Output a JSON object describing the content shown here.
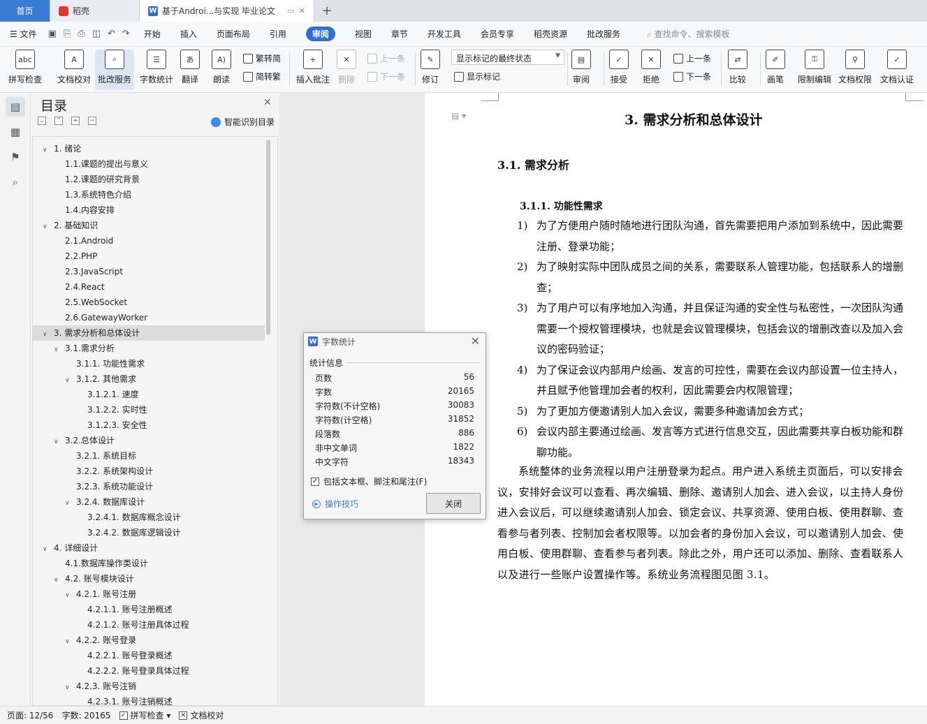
{
  "tabs": [
    {
      "label": "首页"
    },
    {
      "label": "稻壳"
    },
    {
      "label": "基于Androi...与实现 毕业论文"
    }
  ],
  "menu": {
    "file": "文件",
    "items": [
      "开始",
      "插入",
      "页面布局",
      "引用",
      "审阅",
      "视图",
      "章节",
      "开发工具",
      "会员专享",
      "稻壳资源",
      "批改服务"
    ],
    "active": "审阅",
    "search_placeholder": "查找命令、搜索模板"
  },
  "ribbon": {
    "spell_check": "拼写检查",
    "doc_proof": "文档校对",
    "correct_service": "批改服务",
    "word_count": "字数统计",
    "translate": "翻译",
    "read_aloud": "朗读",
    "to_traditional": "繁转简",
    "to_simplified": "简转繁",
    "insert_comment": "插入批注",
    "delete": "删除",
    "prev_comment": "上一条",
    "next_comment": "下一条",
    "track": "修订",
    "markup_state": "显示标记的最终状态",
    "show_markup": "显示标记",
    "review": "审阅",
    "accept": "接受",
    "reject": "拒绝",
    "prev_change": "上一条",
    "next_change": "下一条",
    "compare": "比较",
    "pen": "画笔",
    "restrict_edit": "限制编辑",
    "doc_rights": "文档权限",
    "doc_cert": "文档认证"
  },
  "toc": {
    "title": "目录",
    "smart": "智能识别目录",
    "items": [
      {
        "label": "1. 绪论",
        "level": 1,
        "arrow": "v"
      },
      {
        "label": "1.1.课题的提出与意义",
        "level": 2
      },
      {
        "label": "1.2.课题的研究背景",
        "level": 2
      },
      {
        "label": "1.3.系统特色介绍",
        "level": 2
      },
      {
        "label": "1.4.内容安排",
        "level": 2
      },
      {
        "label": "2. 基础知识",
        "level": 1,
        "arrow": "v"
      },
      {
        "label": "2.1.Android",
        "level": 2
      },
      {
        "label": "2.2.PHP",
        "level": 2
      },
      {
        "label": "2.3.JavaScript",
        "level": 2
      },
      {
        "label": "2.4.React",
        "level": 2
      },
      {
        "label": "2.5.WebSocket",
        "level": 2
      },
      {
        "label": "2.6.GatewayWorker",
        "level": 2
      },
      {
        "label": "3. 需求分析和总体设计",
        "level": 1,
        "arrow": "v",
        "current": true
      },
      {
        "label": "3.1.需求分析",
        "level": 2,
        "arrow": "v"
      },
      {
        "label": "3.1.1.  功能性需求",
        "level": 3
      },
      {
        "label": "3.1.2.  其他需求",
        "level": 3,
        "arrow": "v"
      },
      {
        "label": "3.1.2.1.  速度",
        "level": 4
      },
      {
        "label": "3.1.2.2.  实时性",
        "level": 4
      },
      {
        "label": "3.1.2.3.  安全性",
        "level": 4
      },
      {
        "label": "3.2.总体设计",
        "level": 2,
        "arrow": "v"
      },
      {
        "label": "3.2.1.  系统目标",
        "level": 3
      },
      {
        "label": "3.2.2.  系统架构设计",
        "level": 3
      },
      {
        "label": "3.2.3.  系统功能设计",
        "level": 3
      },
      {
        "label": "3.2.4.  数据库设计",
        "level": 3,
        "arrow": "v"
      },
      {
        "label": "3.2.4.1.  数据库概念设计",
        "level": 4
      },
      {
        "label": "3.2.4.2.  数据库逻辑设计",
        "level": 4
      },
      {
        "label": "4. 详细设计",
        "level": 1,
        "arrow": "v"
      },
      {
        "label": "4.1.数据库操作类设计",
        "level": 2
      },
      {
        "label": "4.2.  账号模块设计",
        "level": 2,
        "arrow": "v"
      },
      {
        "label": "4.2.1.  账号注册",
        "level": 3,
        "arrow": "v"
      },
      {
        "label": "4.2.1.1.  账号注册概述",
        "level": 4
      },
      {
        "label": "4.2.1.2.  账号注册具体过程",
        "level": 4
      },
      {
        "label": "4.2.2.  账号登录",
        "level": 3,
        "arrow": "v"
      },
      {
        "label": "4.2.2.1.  账号登录概述",
        "level": 4
      },
      {
        "label": "4.2.2.2.  账号登录具体过程",
        "level": 4
      },
      {
        "label": "4.2.3.  账号注销",
        "level": 3,
        "arrow": "v"
      },
      {
        "label": "4.2.3.1.  账号注销概述",
        "level": 4
      }
    ]
  },
  "doc": {
    "h1": "3.    需求分析和总体设计",
    "h2": "3.1.  需求分析",
    "h3": "3.1.1.  功能性需求",
    "list": [
      {
        "num": "1)",
        "text": "为了方便用户随时随地进行团队沟通，首先需要把用户添加到系统中，因此需要注册、登录功能；"
      },
      {
        "num": "2)",
        "text": "为了映射实际中团队成员之间的关系，需要联系人管理功能，包括联系人的增删查；"
      },
      {
        "num": "3)",
        "text": "为了用户可以有序地加入沟通，并且保证沟通的安全性与私密性，一次团队沟通需要一个授权管理模块，也就是会议管理模块，包括会议的增删改查以及加入会议的密码验证；"
      },
      {
        "num": "4)",
        "text": "为了保证会议内部用户绘画、发言的可控性，需要在会议内部设置一位主持人，并且赋予他管理加会者的权利，因此需要会内权限管理；"
      },
      {
        "num": "5)",
        "text": "为了更加方便邀请别人加入会议，需要多种邀请加会方式；"
      },
      {
        "num": "6)",
        "text": "会议内部主要通过绘画、发言等方式进行信息交互，因此需要共享白板功能和群聊功能。"
      }
    ],
    "paragraph": "系统整体的业务流程以用户注册登录为起点。用户进入系统主页面后，可以安排会议，安排好会议可以查看、再次编辑、删除、邀请别人加会、进入会议，以主持人身份进入会议后，可以继续邀请别人加会、锁定会议、共享资源、使用白板、使用群聊、查看参与者列表、控制加会者权限等。以加会者的身份加入会议，可以邀请别人加会、使用白板、使用群聊、查看参与者列表。除此之外，用户还可以添加、删除、查看联系人以及进行一些账户设置操作等。系统业务流程图见图 3.1。"
  },
  "dialog": {
    "title": "字数统计",
    "section": "统计信息",
    "rows": [
      {
        "label": "页数",
        "value": "56"
      },
      {
        "label": "字数",
        "value": "20165"
      },
      {
        "label": "字符数(不计空格)",
        "value": "30083"
      },
      {
        "label": "字符数(计空格)",
        "value": "31852"
      },
      {
        "label": "段落数",
        "value": "886"
      },
      {
        "label": "非中文单词",
        "value": "1822"
      },
      {
        "label": "中文字符",
        "value": "18343"
      }
    ],
    "checkbox": "包括文本框、脚注和尾注(F)",
    "tips": "操作技巧",
    "close": "关闭"
  },
  "status": {
    "page": "页面: 12/56",
    "words": "字数: 20165",
    "spell": "拼写检查",
    "proof": "文档校对"
  },
  "colors": {
    "accent": "#2f6fd8",
    "home_tab": "#3a7bd5"
  }
}
